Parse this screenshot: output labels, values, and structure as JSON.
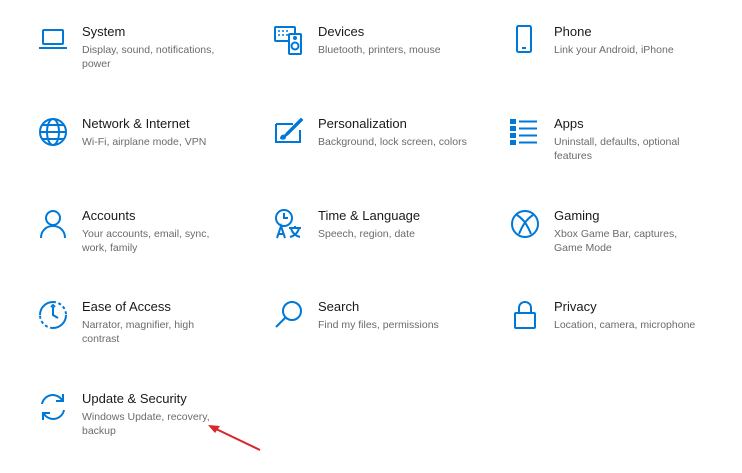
{
  "settings": {
    "items": [
      {
        "title": "System",
        "desc": "Display, sound, notifications, power",
        "icon": "laptop-icon"
      },
      {
        "title": "Devices",
        "desc": "Bluetooth, printers, mouse",
        "icon": "devices-icon"
      },
      {
        "title": "Phone",
        "desc": "Link your Android, iPhone",
        "icon": "phone-icon"
      },
      {
        "title": "Network & Internet",
        "desc": "Wi-Fi, airplane mode, VPN",
        "icon": "globe-icon"
      },
      {
        "title": "Personalization",
        "desc": "Background, lock screen, colors",
        "icon": "brush-icon"
      },
      {
        "title": "Apps",
        "desc": "Uninstall, defaults, optional features",
        "icon": "apps-list-icon"
      },
      {
        "title": "Accounts",
        "desc": "Your accounts, email, sync, work, family",
        "icon": "person-icon"
      },
      {
        "title": "Time & Language",
        "desc": "Speech, region, date",
        "icon": "time-language-icon"
      },
      {
        "title": "Gaming",
        "desc": "Xbox Game Bar, captures, Game Mode",
        "icon": "xbox-icon"
      },
      {
        "title": "Ease of Access",
        "desc": "Narrator, magnifier, high contrast",
        "icon": "ease-of-access-icon"
      },
      {
        "title": "Search",
        "desc": "Find my files, permissions",
        "icon": "search-icon"
      },
      {
        "title": "Privacy",
        "desc": "Location, camera, microphone",
        "icon": "lock-icon"
      },
      {
        "title": "Update & Security",
        "desc": "Windows Update, recovery, backup",
        "icon": "sync-icon"
      }
    ]
  },
  "colors": {
    "accent": "#0078d7",
    "title": "#1a1a1a",
    "description": "#6b6b6b",
    "annotation_arrow": "#d9262c"
  }
}
